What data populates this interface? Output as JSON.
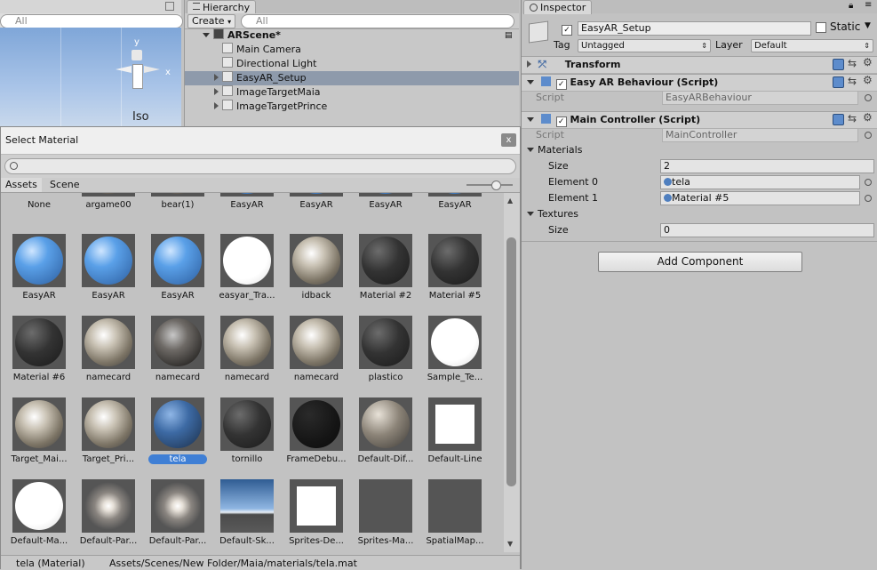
{
  "scene_view": {
    "search_placeholder": "All",
    "gizmo_label": "Iso",
    "axis_y": "y",
    "axis_x": "x"
  },
  "hierarchy": {
    "tab": "Hierarchy",
    "create_label": "Create",
    "search_placeholder": "All",
    "scene_name": "ARScene*",
    "items": [
      {
        "label": "Main Camera",
        "expandable": false,
        "selected": false
      },
      {
        "label": "Directional Light",
        "expandable": false,
        "selected": false
      },
      {
        "label": "EasyAR_Setup",
        "expandable": true,
        "selected": true
      },
      {
        "label": "ImageTargetMaia",
        "expandable": true,
        "selected": false
      },
      {
        "label": "ImageTargetPrince",
        "expandable": true,
        "selected": false
      }
    ]
  },
  "select_material": {
    "title": "Select Material",
    "close_label": "x",
    "tabs": [
      "Assets",
      "Scene"
    ],
    "partial_row": [
      "None",
      "argame00",
      "bear(1)",
      "EasyAR",
      "EasyAR",
      "EasyAR",
      "EasyAR"
    ],
    "rows": [
      [
        {
          "label": "EasyAR",
          "kind": "blue"
        },
        {
          "label": "EasyAR",
          "kind": "blue"
        },
        {
          "label": "EasyAR",
          "kind": "blue"
        },
        {
          "label": "easyar_Tra...",
          "kind": "white"
        },
        {
          "label": "idback",
          "kind": "photo"
        },
        {
          "label": "Material #2",
          "kind": "dark"
        },
        {
          "label": "Material #5",
          "kind": "dark"
        }
      ],
      [
        {
          "label": "Material #6",
          "kind": "dark"
        },
        {
          "label": "namecard",
          "kind": "photo"
        },
        {
          "label": "namecard",
          "kind": "darkphoto"
        },
        {
          "label": "namecard",
          "kind": "photo"
        },
        {
          "label": "namecard",
          "kind": "photo"
        },
        {
          "label": "plastico",
          "kind": "dark"
        },
        {
          "label": "Sample_Te...",
          "kind": "white"
        }
      ],
      [
        {
          "label": "Target_Mai...",
          "kind": "photo"
        },
        {
          "label": "Target_Pri...",
          "kind": "photo"
        },
        {
          "label": "tela",
          "kind": "blue-dark",
          "selected": true
        },
        {
          "label": "tornillo",
          "kind": "dark"
        },
        {
          "label": "FrameDebu...",
          "kind": "black"
        },
        {
          "label": "Default-Dif...",
          "kind": "grey"
        },
        {
          "label": "Default-Line",
          "kind": "white-square"
        }
      ],
      [
        {
          "label": "Default-Ma...",
          "kind": "white"
        },
        {
          "label": "Default-Par...",
          "kind": "glow"
        },
        {
          "label": "Default-Par...",
          "kind": "glow"
        },
        {
          "label": "Default-Sk...",
          "kind": "sky"
        },
        {
          "label": "Sprites-De...",
          "kind": "white-square"
        },
        {
          "label": "Sprites-Ma...",
          "kind": "empty"
        },
        {
          "label": "SpatialMap...",
          "kind": "empty"
        }
      ]
    ],
    "status_name": "tela (Material)",
    "status_path": "Assets/Scenes/New Folder/Maia/materials/tela.mat"
  },
  "inspector": {
    "tab": "Inspector",
    "object_name": "EasyAR_Setup",
    "static_label": "Static",
    "tag_label": "Tag",
    "tag_value": "Untagged",
    "layer_label": "Layer",
    "layer_value": "Default",
    "transform_label": "Transform",
    "easyar_component": {
      "title": "Easy AR Behaviour (Script)",
      "script_label": "Script",
      "script_value": "EasyARBehaviour"
    },
    "main_controller": {
      "title": "Main Controller (Script)",
      "script_label": "Script",
      "script_value": "MainController",
      "materials_label": "Materials",
      "size_label": "Size",
      "materials_size": "2",
      "element0_label": "Element 0",
      "element0_value": "tela",
      "element1_label": "Element 1",
      "element1_value": "Material #5",
      "textures_label": "Textures",
      "textures_size_label": "Size",
      "textures_size": "0"
    },
    "add_component_label": "Add Component"
  },
  "colors": {
    "accent": "#3f7fd5",
    "selected_row": "#8e9aab",
    "panel": "#c2c2c2"
  }
}
